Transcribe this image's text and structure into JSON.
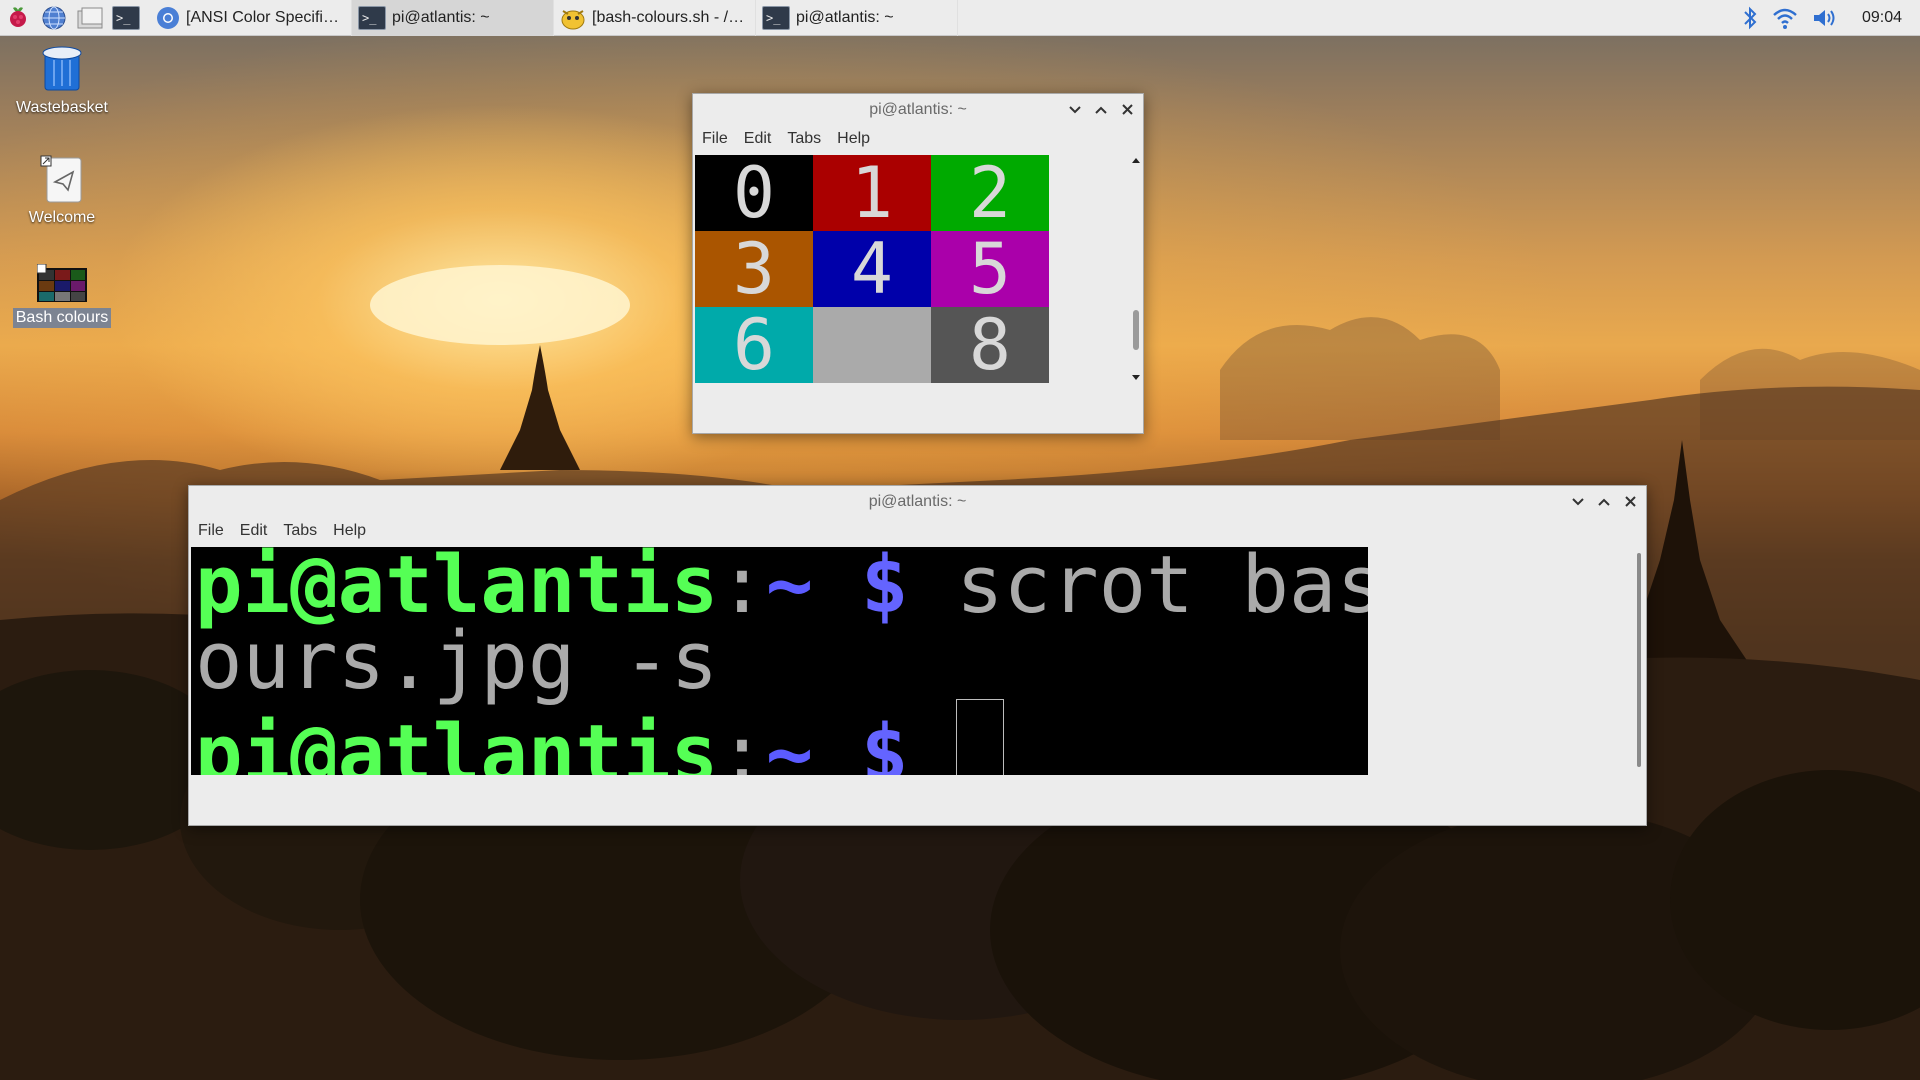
{
  "taskbar": {
    "launchers": [
      "raspberry-menu",
      "web-browser",
      "file-manager",
      "terminal"
    ],
    "tasks": [
      {
        "label": "[ANSI Color Specific ...",
        "icon": "chromium-icon",
        "active": false
      },
      {
        "label": "pi@atlantis: ~",
        "icon": "terminal-icon",
        "active": true
      },
      {
        "label": "[bash-colours.sh - /h...",
        "icon": "text-editor-icon",
        "active": false
      },
      {
        "label": "pi@atlantis: ~",
        "icon": "terminal-icon",
        "active": false
      }
    ],
    "tray": {
      "bluetooth": "bluetooth-icon",
      "wifi": "wifi-icon",
      "volume": "volume-icon",
      "clock": "09:04"
    },
    "term_glyph": ">_"
  },
  "desktop": {
    "icons": [
      {
        "label": "Wastebasket",
        "icon": "trash-icon"
      },
      {
        "label": "Welcome",
        "icon": "welcome-icon"
      },
      {
        "label": "Bash colours",
        "icon": "image-file-icon",
        "selected": true
      }
    ]
  },
  "palette_window": {
    "title": "pi@atlantis: ~",
    "menu": [
      "File",
      "Edit",
      "Tabs",
      "Help"
    ],
    "cells": [
      {
        "label": "0",
        "color": "#000000"
      },
      {
        "label": "1",
        "color": "#aa0000"
      },
      {
        "label": "2",
        "color": "#00aa00"
      },
      {
        "label": "3",
        "color": "#aa5500"
      },
      {
        "label": "4",
        "color": "#0000aa"
      },
      {
        "label": "5",
        "color": "#aa00aa"
      },
      {
        "label": "6",
        "color": "#00aaaa"
      },
      {
        "label": "",
        "color": "#aaaaaa"
      },
      {
        "label": "8",
        "color": "#555555"
      }
    ]
  },
  "terminal_window": {
    "title": "pi@atlantis: ~",
    "menu": [
      "File",
      "Edit",
      "Tabs",
      "Help"
    ],
    "prompt": {
      "user_host": "pi@atlantis",
      "colon": ":",
      "path": "~",
      "symbol": "$"
    },
    "line1_cmd": " scrot bash-col",
    "line2": "ours.jpg -s",
    "colors": {
      "user": "#55ff55",
      "symbol": "#6464ff",
      "text": "#aaaaaa"
    }
  }
}
